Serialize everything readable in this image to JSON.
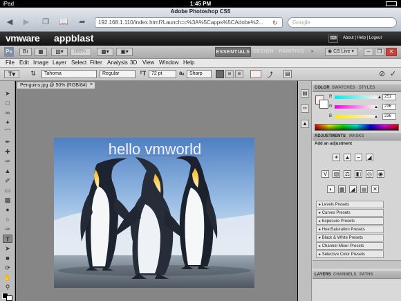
{
  "status": {
    "device": "iPad",
    "time": "1:45 PM",
    "battery": "▬"
  },
  "browser": {
    "page_title": "Adobe Photoshop CS5",
    "url": "192.168.1.110/index.html?Launch=c%3A%5Capps%5CAdobe%2...",
    "search_placeholder": "Google"
  },
  "vmware": {
    "logo": "vmware",
    "product": "appblast",
    "links": "About | Help | Logout"
  },
  "appbar": {
    "ps_logo": "Ps",
    "zoom": "100%",
    "workspaces": [
      "ESSENTIALS",
      "DESIGN",
      "PAINTING"
    ],
    "more": "»",
    "cslive": "CS Live"
  },
  "menu": [
    "File",
    "Edit",
    "Image",
    "Layer",
    "Select",
    "Filter",
    "Analysis",
    "3D",
    "View",
    "Window",
    "Help"
  ],
  "options": {
    "font_family": "Tahoma",
    "font_style": "Regular",
    "font_size": "72 pt",
    "antialias": "Sharp"
  },
  "document": {
    "tab_title": "Penguins.jpg @ 50% (RGB/8#)",
    "overlay_text": "hello vmworld"
  },
  "color_panel": {
    "tabs": [
      "COLOR",
      "SWATCHES",
      "STYLES"
    ],
    "channels": [
      {
        "name": "R",
        "value": "251",
        "pos": 0.98
      },
      {
        "name": "G",
        "value": "236",
        "pos": 0.92
      },
      {
        "name": "B",
        "value": "236",
        "pos": 0.92
      }
    ],
    "colors": {
      "fg": "#fbecec",
      "bg": "#ffffff"
    }
  },
  "adjustments": {
    "tabs": [
      "ADJUSTMENTS",
      "MASKS"
    ],
    "heading": "Add an adjustment",
    "presets": [
      "Levels Presets",
      "Curves Presets",
      "Exposure Presets",
      "Hue/Saturation Presets",
      "Black & White Presets",
      "Channel Mixer Presets",
      "Selective Color Presets"
    ]
  },
  "layers": {
    "tabs": [
      "LAYERS",
      "CHANNELS",
      "PATHS"
    ]
  }
}
